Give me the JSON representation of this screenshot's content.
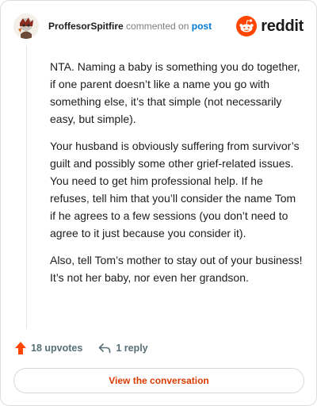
{
  "header": {
    "author": "ProffesorSpitfire",
    "action": "commented on",
    "post_link": "post",
    "brand": "reddit"
  },
  "comment": {
    "paragraphs": [
      "NTA. Naming a baby is something you do together, if one parent doesn’t like a name you go with something else, it’s that simple (not necessarily easy, but simple).",
      "Your husband is obviously suffering from survivor’s guilt and possibly some other grief-related issues. You need to get him professional help. If he refuses, tell him that you’ll consider the name Tom if he agrees to a few sessions (you don’t need to agree to it just because you consider it).",
      "Also, tell Tom’s mother to stay out of your business! It’s not her baby, nor even her grandson."
    ]
  },
  "footer": {
    "upvotes": "18 upvotes",
    "replies": "1 reply"
  },
  "cta": {
    "label": "View the conversation"
  },
  "colors": {
    "accent": "#ff4500",
    "link": "#0079d3",
    "cta_text": "#d93a00"
  },
  "icons": {
    "avatar": "user-avatar-icon",
    "logo": "reddit-logo-icon",
    "upvote": "upvote-arrow-icon",
    "reply": "reply-arrow-icon"
  }
}
